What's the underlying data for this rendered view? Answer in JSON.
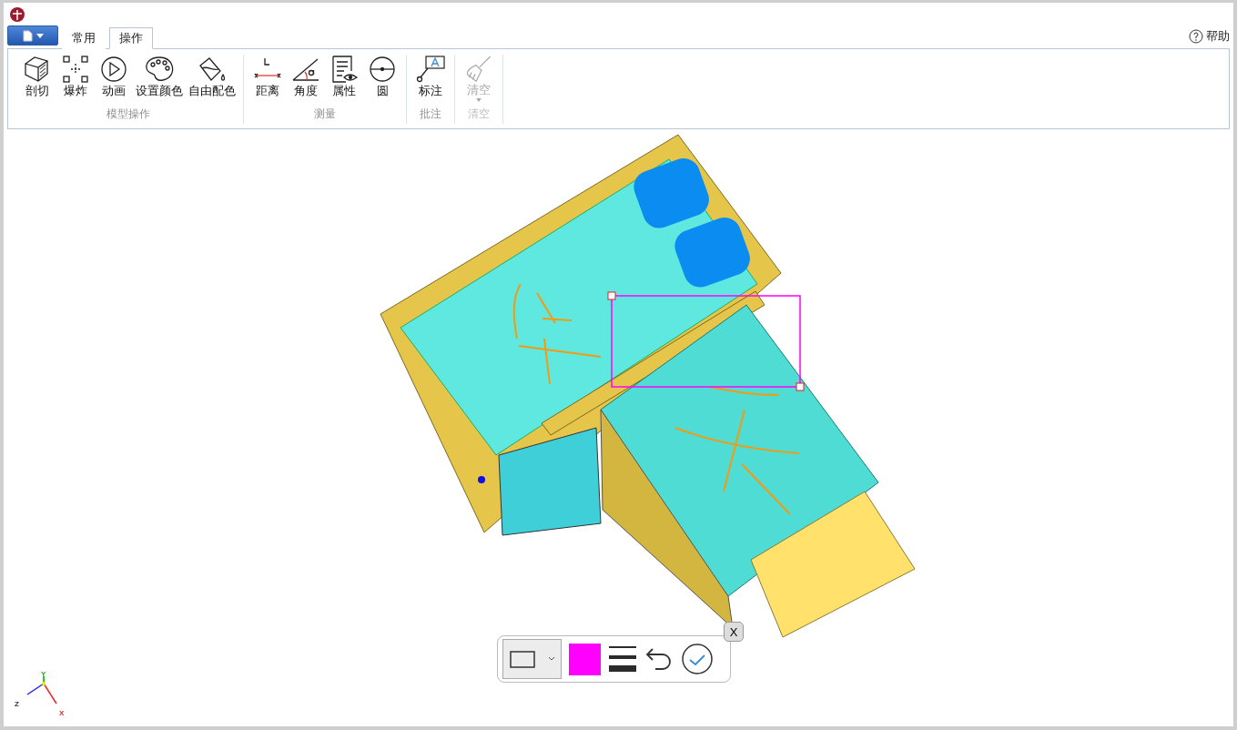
{
  "tabs": [
    {
      "label": "常用",
      "selected": false
    },
    {
      "label": "操作",
      "selected": true
    }
  ],
  "help": {
    "label": "帮助"
  },
  "ribbon": {
    "groups": [
      {
        "label": "模型操作",
        "disabled": false,
        "items": [
          {
            "label": "剖切",
            "disabled": false
          },
          {
            "label": "爆炸",
            "disabled": false
          },
          {
            "label": "动画",
            "disabled": false
          },
          {
            "label": "设置颜色",
            "disabled": false
          },
          {
            "label": "自由配色",
            "disabled": false
          }
        ]
      },
      {
        "label": "测量",
        "disabled": false,
        "items": [
          {
            "label": "距离",
            "disabled": false
          },
          {
            "label": "角度",
            "disabled": false
          },
          {
            "label": "属性",
            "disabled": false
          },
          {
            "label": "圆",
            "disabled": false
          }
        ]
      },
      {
        "label": "批注",
        "disabled": false,
        "items": [
          {
            "label": "标注",
            "disabled": false
          }
        ]
      },
      {
        "label": "清空",
        "disabled": true,
        "items": [
          {
            "label": "清空",
            "disabled": true,
            "dropdown": true
          }
        ]
      }
    ]
  },
  "annotation_toolbar": {
    "tools": [
      {
        "kind": "shape",
        "selected": true
      },
      {
        "kind": "color",
        "color": "#ff00ff"
      },
      {
        "kind": "width"
      },
      {
        "kind": "undo"
      },
      {
        "kind": "confirm"
      }
    ],
    "close": "X"
  },
  "axes": {
    "labels": [
      "Y",
      "Z",
      "X"
    ]
  }
}
